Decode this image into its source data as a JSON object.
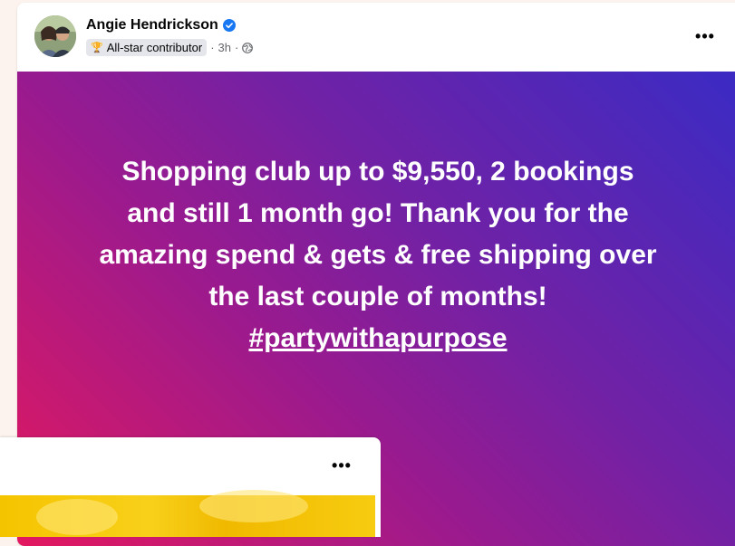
{
  "post": {
    "author": "Angie Hendrickson",
    "badge_label": "All-star contributor",
    "separator_1": "·",
    "time": "3h",
    "separator_2": "·",
    "more_label": "•••",
    "text_lines": [
      "Shopping club up to $9,550, 2 bookings",
      "and still 1 month go! Thank you for the",
      "amazing spend & gets & free shipping over",
      "the last couple of months!"
    ],
    "hashtag": "#partywithapurpose",
    "gradient_colors": [
      "#e3185f",
      "#9b1a8e",
      "#7321a4",
      "#3a2bc4"
    ]
  },
  "post2": {
    "more_label": "•••",
    "media_color": "#f5c400"
  },
  "icons": {
    "verified": "verified-badge-icon",
    "trophy": "trophy-icon",
    "privacy": "globe-icon"
  }
}
